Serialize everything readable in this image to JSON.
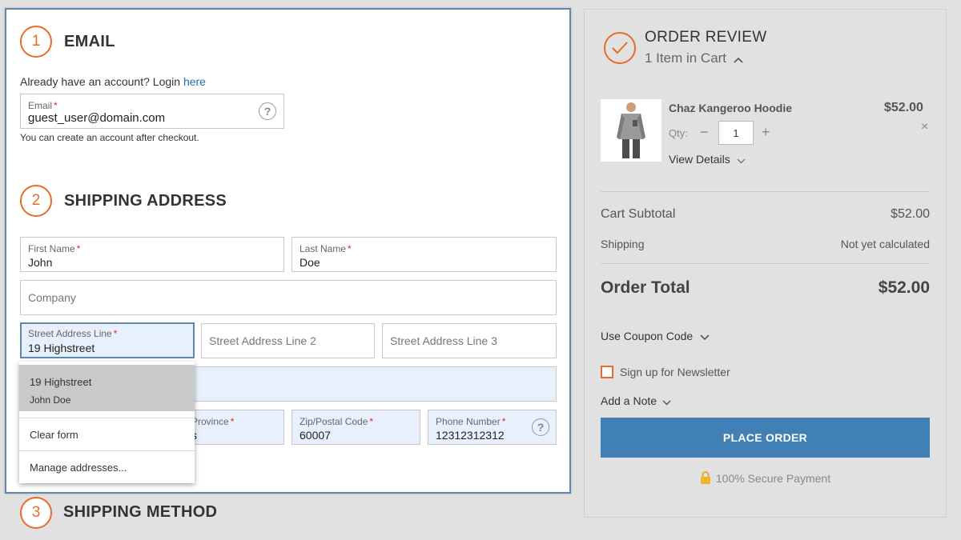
{
  "email_step": {
    "number": "1",
    "title": "EMAIL",
    "account_prompt": "Already have an account? Login",
    "login_link": "here",
    "email_label": "Email",
    "email_value": "guest_user@domain.com",
    "help": "?",
    "note": "You can create an account after checkout."
  },
  "shipping_step": {
    "number": "2",
    "title": "SHIPPING ADDRESS",
    "first_name_label": "First Name",
    "first_name_value": "John",
    "last_name_label": "Last Name",
    "last_name_value": "Doe",
    "company_placeholder": "Company",
    "street1_label": "Street Address Line",
    "street1_value": "19 Highstreet",
    "street2_placeholder": "Street Address Line 2",
    "street3_placeholder": "Street Address Line 3",
    "province_label": "Province",
    "province_value": "s",
    "zip_label": "Zip/Postal Code",
    "zip_value": "60007",
    "phone_label": "Phone Number",
    "phone_value": "12312312312",
    "help": "?"
  },
  "autocomplete": {
    "address_line": "19 Highstreet",
    "name": "John Doe",
    "clear": "Clear form",
    "manage": "Manage addresses..."
  },
  "method_step": {
    "number": "3",
    "title": "SHIPPING METHOD"
  },
  "order_review": {
    "title": "ORDER REVIEW",
    "items_in_cart": "1 Item in Cart",
    "product_name": "Chaz Kangeroo Hoodie",
    "product_price": "$52.00",
    "qty_label": "Qty:",
    "qty_value": "1",
    "minus": "−",
    "plus": "+",
    "remove": "×",
    "view_details": "View Details",
    "subtotal_label": "Cart Subtotal",
    "subtotal_value": "$52.00",
    "shipping_label": "Shipping",
    "shipping_value": "Not yet calculated",
    "total_label": "Order Total",
    "total_value": "$52.00",
    "coupon": "Use Coupon Code",
    "newsletter": "Sign up for Newsletter",
    "add_note": "Add a Note",
    "place_order": "PLACE ORDER",
    "secure": "100% Secure Payment"
  },
  "colors": {
    "accent": "#e96a2a",
    "button": "#4180b4",
    "link": "#1d6fb3",
    "required": "#e02b27"
  }
}
